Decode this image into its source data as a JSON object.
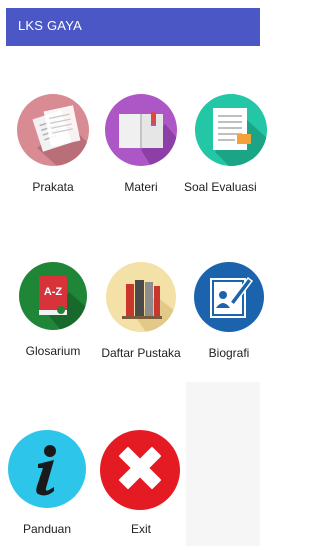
{
  "appbar": {
    "title": "LKS GAYA"
  },
  "menu": {
    "items": [
      {
        "label": "Prakata",
        "icon": "document-icon",
        "color": "#d98b93"
      },
      {
        "label": "Materi",
        "icon": "book-icon",
        "color": "#ad57c7"
      },
      {
        "label": "Soal Evaluasi",
        "icon": "exam-paper-icon",
        "color": "#24c7a5"
      },
      {
        "label": "Glosarium",
        "icon": "glossary-book-icon",
        "color": "#1f8537"
      },
      {
        "label": "Daftar Pustaka",
        "icon": "books-icon",
        "color": "#f3e1a8"
      },
      {
        "label": "Biografi",
        "icon": "biography-icon",
        "color": "#1b63ad"
      },
      {
        "label": "Panduan",
        "icon": "info-icon",
        "color": "#2ec5ea"
      },
      {
        "label": "Exit",
        "icon": "exit-x-icon",
        "color": "#e51b24"
      }
    ]
  },
  "icons_text": {
    "glossary_az": "A-Z"
  }
}
